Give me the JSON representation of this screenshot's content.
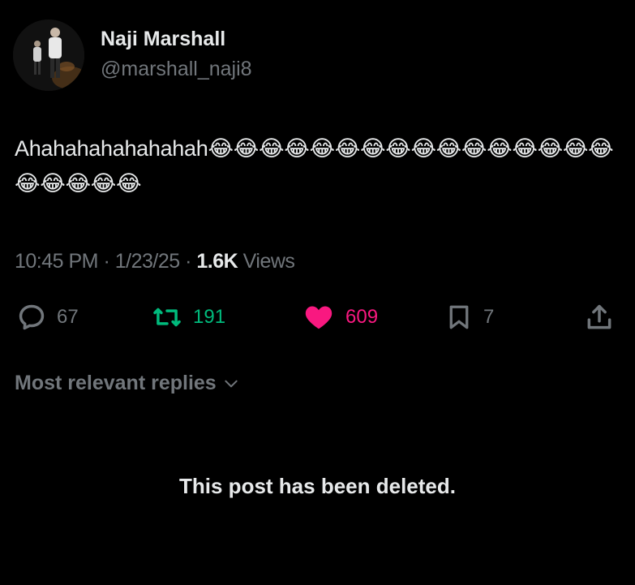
{
  "author": {
    "display_name": "Naji Marshall",
    "handle": "@marshall_naji8",
    "avatar": "profile-photo"
  },
  "tweet": {
    "text": "Ahahahahahahahah😂😂😂😂😂😂😂😂😂😂😂😂😂😂😂😂😂😂😂😂😂"
  },
  "meta": {
    "time": "10:45 PM",
    "separator": "·",
    "date": "1/23/25",
    "views_count": "1.6K",
    "views_label": "Views"
  },
  "actions": {
    "reply": {
      "icon": "reply-icon",
      "count": "67",
      "color": "#71767b"
    },
    "retweet": {
      "icon": "retweet-icon",
      "count": "191",
      "color": "#00ba7c"
    },
    "like": {
      "icon": "heart-icon",
      "count": "609",
      "color": "#f91880"
    },
    "bookmark": {
      "icon": "bookmark-icon",
      "count": "7",
      "color": "#71767b"
    },
    "share": {
      "icon": "share-icon"
    }
  },
  "replies": {
    "sort_label": "Most relevant replies",
    "deleted_notice": "This post has been deleted."
  },
  "colors": {
    "background": "#000000",
    "primary_text": "#e7e9ea",
    "secondary_text": "#71767b"
  }
}
